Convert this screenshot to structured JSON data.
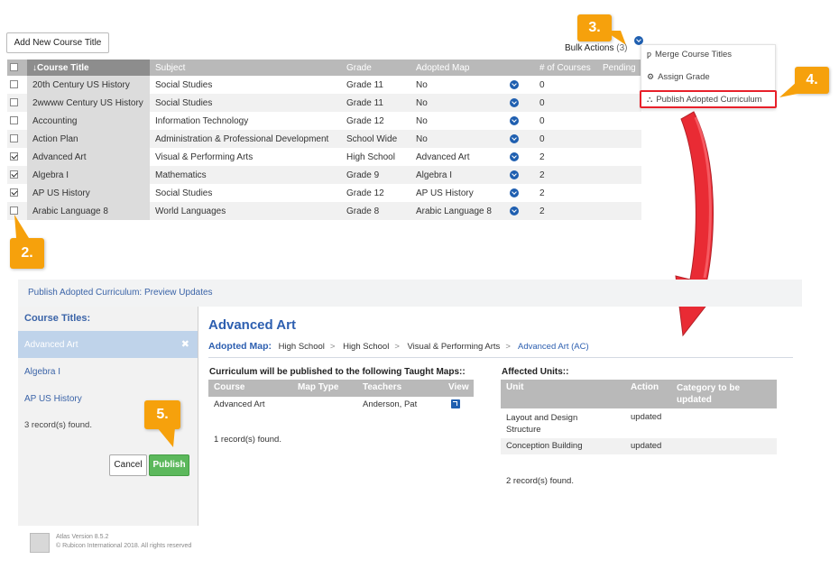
{
  "toolbar": {
    "add_button": "Add New Course Title",
    "bulk_label": "Bulk Actions",
    "bulk_count": "(3)"
  },
  "table": {
    "headers": [
      "↓Course Title",
      "Subject",
      "Grade",
      "Adopted Map",
      "# of Courses",
      "Pending"
    ],
    "rows": [
      {
        "checked": false,
        "title": "20th Century US History",
        "subject": "Social Studies",
        "grade": "Grade 11",
        "map": "No",
        "courses": "0"
      },
      {
        "checked": false,
        "title": "2wwww Century US History",
        "subject": "Social Studies",
        "grade": "Grade 11",
        "map": "No",
        "courses": "0"
      },
      {
        "checked": false,
        "title": "Accounting",
        "subject": "Information Technology",
        "grade": "Grade 12",
        "map": "No",
        "courses": "0"
      },
      {
        "checked": false,
        "title": "Action Plan",
        "subject": "Administration & Professional Development",
        "grade": "School Wide",
        "map": "No",
        "courses": "0"
      },
      {
        "checked": true,
        "title": "Advanced Art",
        "subject": "Visual & Performing Arts",
        "grade": "High School",
        "map": "Advanced Art",
        "courses": "2"
      },
      {
        "checked": true,
        "title": "Algebra I",
        "subject": "Mathematics",
        "grade": "Grade 9",
        "map": "Algebra I",
        "courses": "2"
      },
      {
        "checked": true,
        "title": "AP US History",
        "subject": "Social Studies",
        "grade": "Grade 12",
        "map": "AP US History",
        "courses": "2"
      },
      {
        "checked": false,
        "title": "Arabic Language 8",
        "subject": "World Languages",
        "grade": "Grade 8",
        "map": "Arabic Language 8",
        "courses": "2"
      }
    ]
  },
  "dropdown": {
    "items": [
      {
        "icon": "merge-icon",
        "label": "Merge Course Titles"
      },
      {
        "icon": "gears-icon",
        "label": "Assign Grade"
      },
      {
        "icon": "sitemap-icon",
        "label": "Publish Adopted Curriculum"
      }
    ]
  },
  "callouts": {
    "c2": "2.",
    "c3": "3.",
    "c4": "4.",
    "c5": "5."
  },
  "preview": {
    "header": "Publish Adopted Curriculum: Preview Updates",
    "left_title": "Course Titles:",
    "left_items": [
      "Advanced Art",
      "Algebra I",
      "AP US History"
    ],
    "left_found": "3 record(s) found.",
    "cancel": "Cancel",
    "publish": "Publish",
    "title": "Advanced Art",
    "adopted_label": "Adopted Map:",
    "crumbs": [
      "High School",
      "High School",
      "Visual & Performing Arts",
      "Advanced Art (AC)"
    ],
    "taught_title": "Curriculum will be published to the following Taught Maps::",
    "taught_headers": [
      "Course",
      "Map Type",
      "Teachers",
      "View"
    ],
    "taught_row": {
      "course": "Advanced Art",
      "map_type": "",
      "teachers": "Anderson, Pat"
    },
    "taught_found": "1 record(s) found.",
    "units_title": "Affected Units::",
    "units_headers": [
      "Unit",
      "Action",
      "Category to be updated"
    ],
    "units_rows": [
      {
        "unit": "Layout and Design Structure",
        "action": "updated"
      },
      {
        "unit": "Conception Building",
        "action": "updated"
      }
    ],
    "units_found": "2 record(s) found."
  },
  "footer": {
    "version": "Atlas Version 8.5.2",
    "copyright": "© Rubicon International 2018. All rights reserved"
  },
  "colors": {
    "accent": "#2d5fb0",
    "callout": "#f6a10c",
    "arrow": "#e8202a",
    "publish": "#5cb85c"
  }
}
